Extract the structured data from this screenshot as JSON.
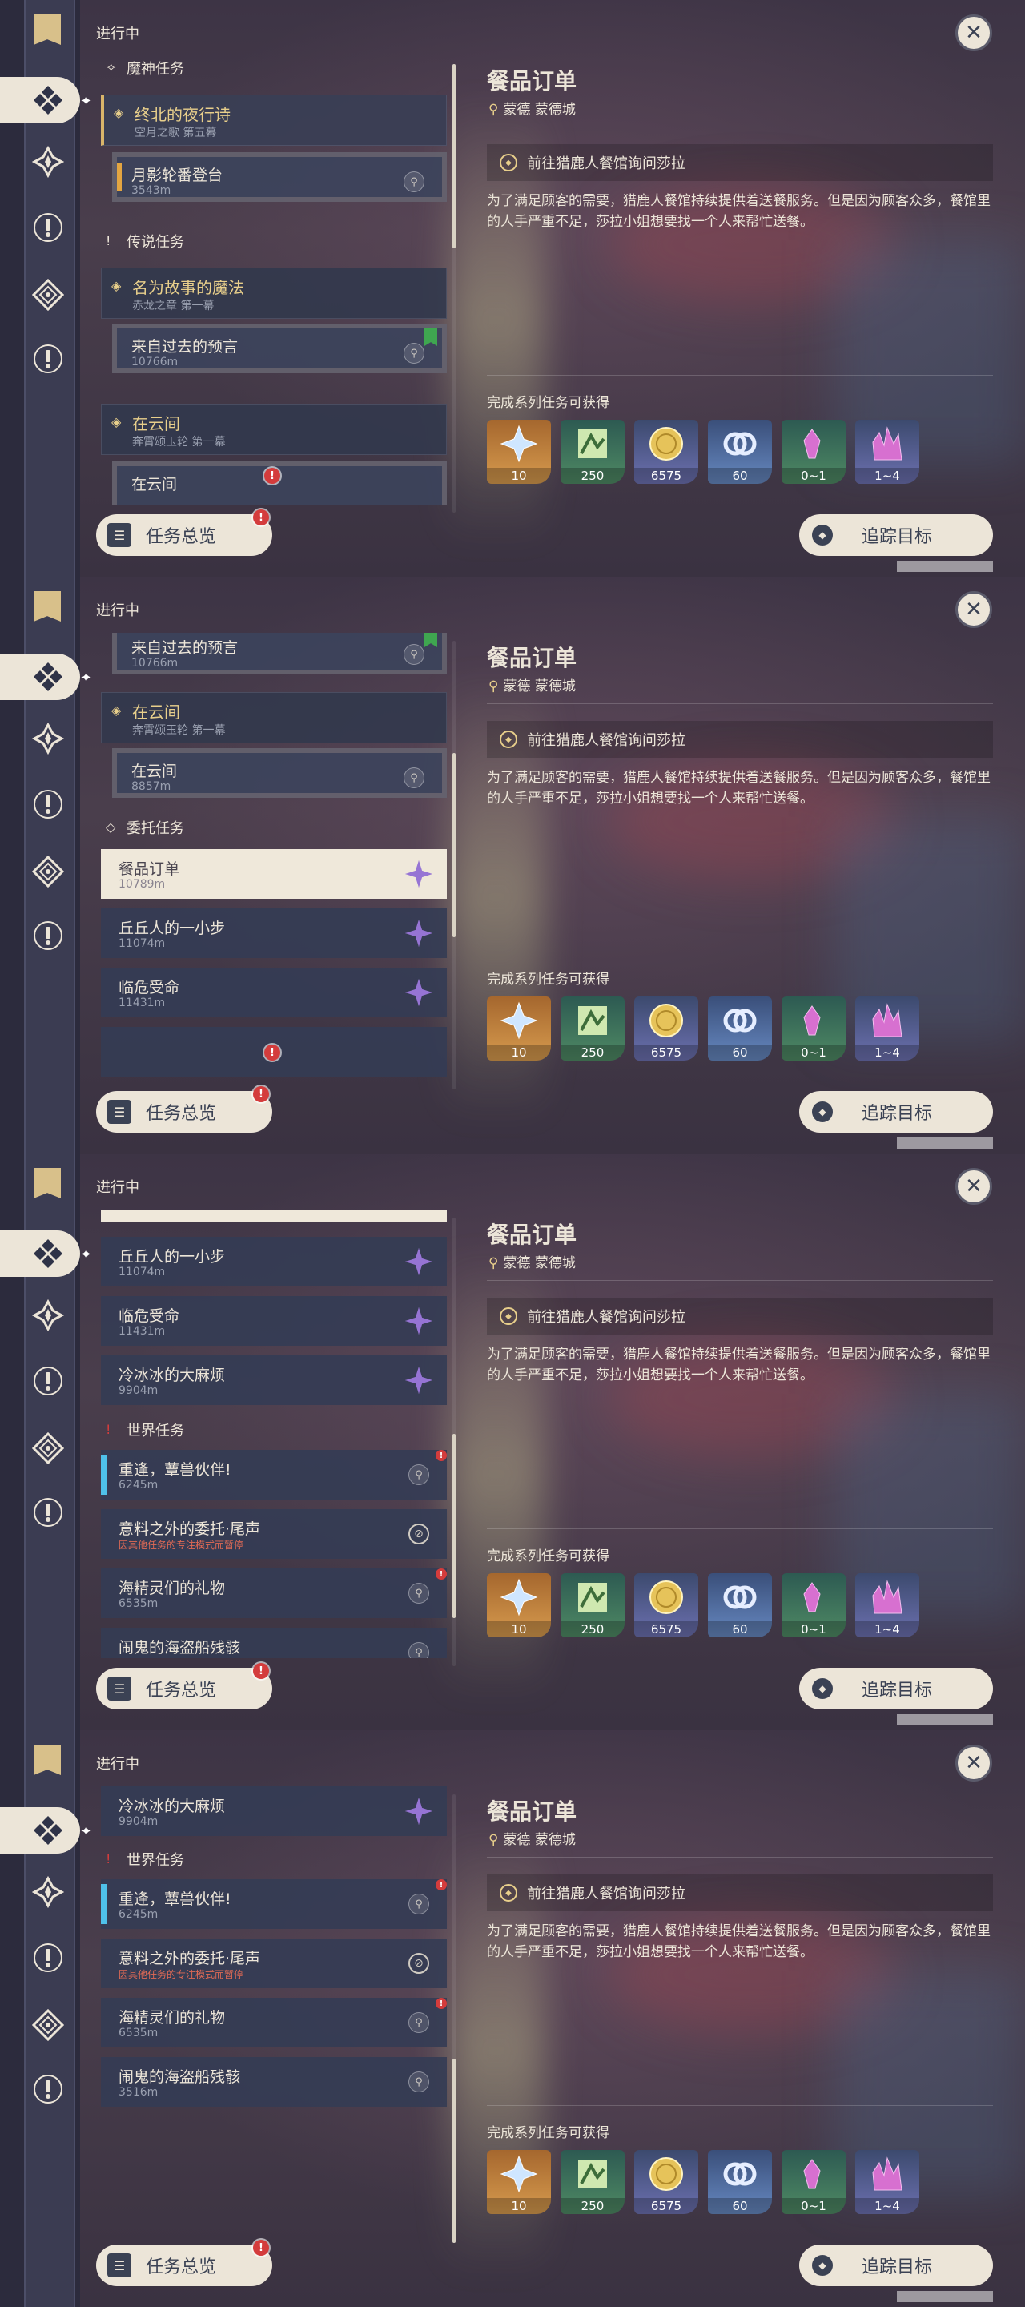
{
  "common": {
    "status_label": "进行中",
    "overview_label": "任务总览",
    "track_label": "追踪目标",
    "detail": {
      "title": "餐品订单",
      "location": "蒙德 蒙德城",
      "step": "前往猎鹿人餐馆询问莎拉",
      "description": "为了满足顾客的需要，猎鹿人餐馆持续提供着送餐服务。但是因为顾客众多，餐馆里的人手严重不足，莎拉小姐想要找一个人来帮忙送餐。",
      "reward_label": "完成系列任务可获得",
      "rewards": [
        {
          "icon": "primogem-icon",
          "count": "10"
        },
        {
          "icon": "adventure-exp-icon",
          "count": "250"
        },
        {
          "icon": "mora-icon",
          "count": "6575"
        },
        {
          "icon": "friendship-exp-icon",
          "count": "60"
        },
        {
          "icon": "crystal-small-icon",
          "count": "0~1"
        },
        {
          "icon": "crystal-large-icon",
          "count": "1~4"
        }
      ]
    }
  },
  "panel1": {
    "cat_archon": "魔神任务",
    "g1_title": "终北的夜行诗",
    "g1_sub": "空月之歌 第五幕",
    "s1_title": "月影轮番登台",
    "s1_dist": "3543m",
    "cat_legend": "传说任务",
    "g2_title": "名为故事的魔法",
    "g2_sub": "赤龙之章 第一幕",
    "s2_title": "来自过去的预言",
    "s2_dist": "10766m",
    "g3_title": "在云间",
    "g3_sub": "奔霄颂玉轮 第一幕",
    "s3_title": "在云间"
  },
  "panel2": {
    "s1_title": "来自过去的预言",
    "s1_dist": "10766m",
    "g1_title": "在云间",
    "g1_sub": "奔霄颂玉轮 第一幕",
    "s2_title": "在云间",
    "s2_dist": "8857m",
    "cat_commission": "委托任务",
    "c1_title": "餐品订单",
    "c1_dist": "10789m",
    "c2_title": "丘丘人的一小步",
    "c2_dist": "11074m",
    "c3_title": "临危受命",
    "c3_dist": "11431m"
  },
  "panel3": {
    "c1_title": "丘丘人的一小步",
    "c1_dist": "11074m",
    "c2_title": "临危受命",
    "c2_dist": "11431m",
    "c3_title": "冷冰冰的大麻烦",
    "c3_dist": "9904m",
    "cat_world": "世界任务",
    "w1_title": "重逢，蕈兽伙伴!",
    "w1_dist": "6245m",
    "w2_title": "意料之外的委托·尾声",
    "w2_warn": "因其他任务的专注模式而暂停",
    "w3_title": "海精灵们的礼物",
    "w3_dist": "6535m",
    "w4_title": "闹鬼的海盗船残骸"
  },
  "panel4": {
    "c1_title": "冷冰冰的大麻烦",
    "c1_dist": "9904m",
    "cat_world": "世界任务",
    "w1_title": "重逢，蕈兽伙伴!",
    "w1_dist": "6245m",
    "w2_title": "意料之外的委托·尾声",
    "w2_warn": "因其他任务的专注模式而暂停",
    "w3_title": "海精灵们的礼物",
    "w3_dist": "6535m",
    "w4_title": "闹鬼的海盗船残骸",
    "w4_dist": "3516m"
  },
  "colors": {
    "accent_gold": "#e8cf8b",
    "cream": "#ece5d8",
    "alert_red": "#d43c3c",
    "commission_purple": "#9674d4"
  }
}
